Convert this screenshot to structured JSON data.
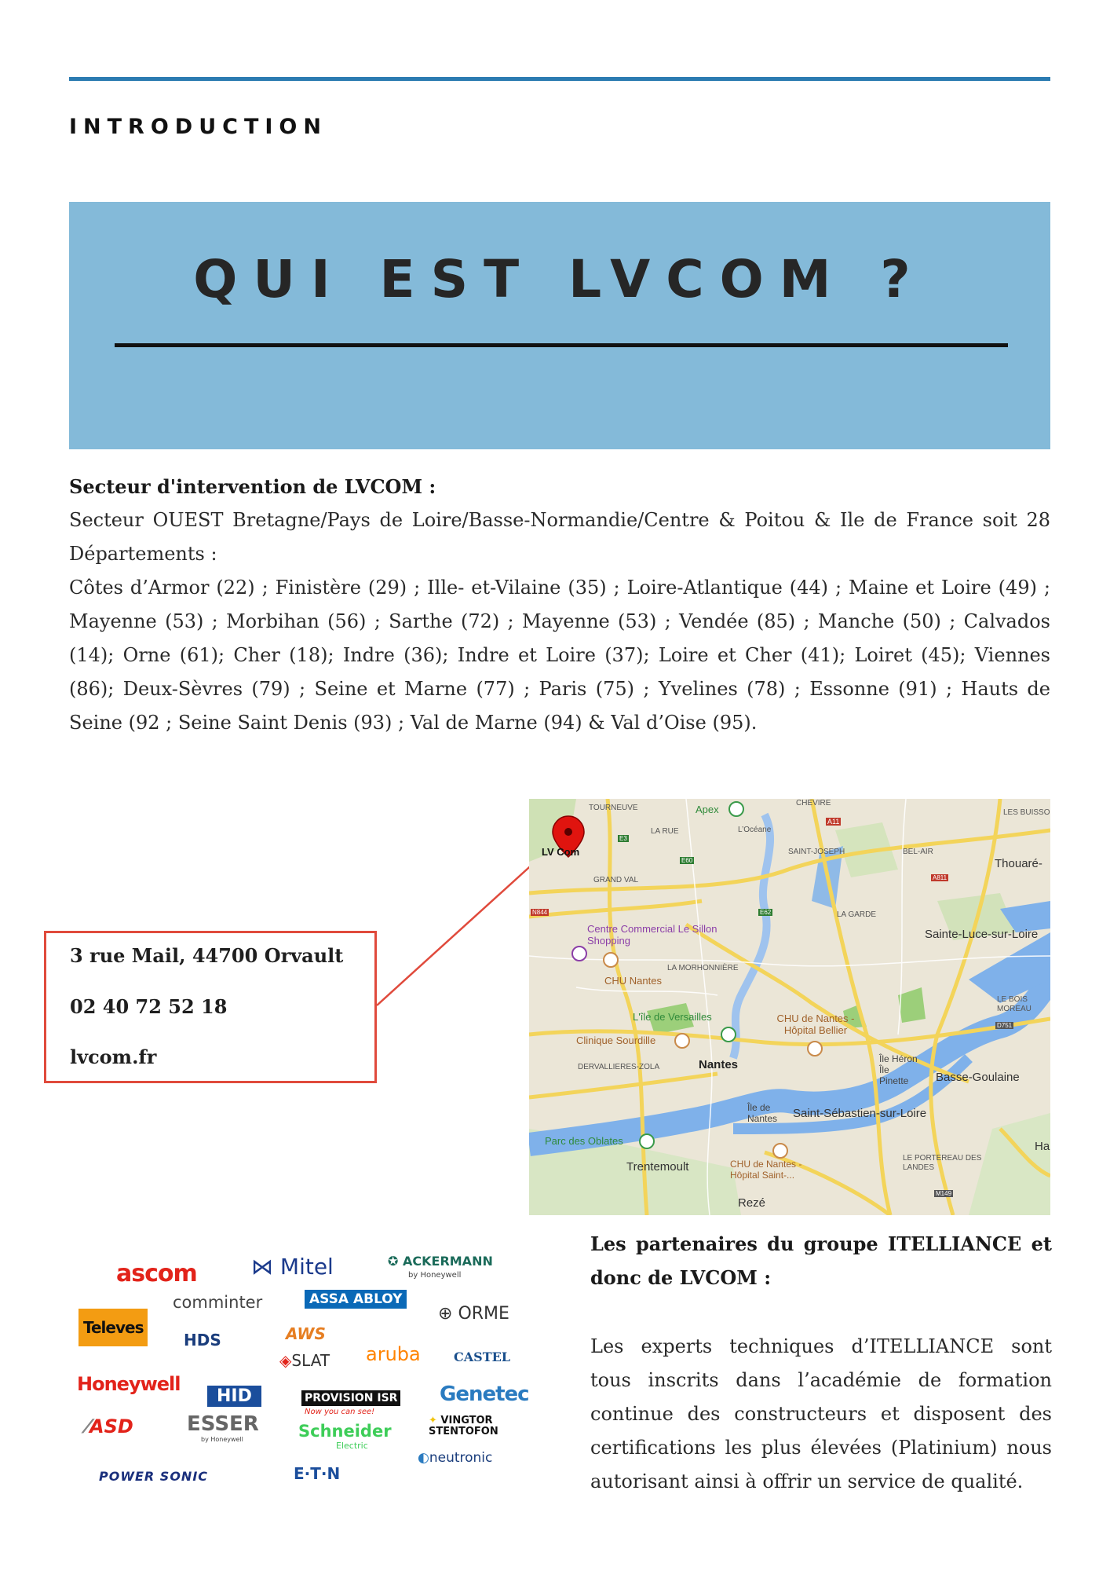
{
  "header": {
    "section_label": "INTRODUCTION"
  },
  "banner": {
    "title": "QUI EST LVCOM ?"
  },
  "sector": {
    "heading": "Secteur d'intervention de LVCOM :",
    "paragraph_1": "Secteur OUEST Bretagne/Pays de Loire/Basse-Normandie/Centre & Poitou & Ile de France soit 28 Départements :",
    "paragraph_2": "Côtes d’Armor (22) ; Finistère (29) ; Ille- et-Vilaine (35) ; Loire-Atlantique (44) ; Maine et Loire (49) ; Mayenne (53) ; Morbihan (56) ; Sarthe (72) ; Mayenne (53) ; Vendée (85) ; Manche (50) ; Calvados (14); Orne (61); Cher (18); Indre (36); Indre et Loire (37); Loire et Cher (41); Loiret (45); Viennes (86); Deux-Sèvres (79) ; Seine et Marne (77) ; Paris (75) ; Yvelines (78) ; Essonne (91) ; Hauts de Seine (92 ; Seine Saint Denis (93) ; Val de Marne (94) & Val d’Oise (95)."
  },
  "contact": {
    "address": "3 rue Mail, 44700 Orvault",
    "phone": "02 40 72 52 18",
    "website": "lvcom.fr"
  },
  "map": {
    "marker_label": "LV Com",
    "places": {
      "tourneuve": "TOURNEUVE",
      "apex": "Apex",
      "chevire": "CHEVIRE",
      "les_buisson": "LES BUISSO",
      "la_rue": "LA RUE",
      "l_oceane": "L’Océane",
      "a11": "A11",
      "saint_joseph": "SAINT-JOSEPH",
      "bel_air": "BEL-AIR",
      "thouare": "Thouaré-",
      "e3": "E3",
      "e60": "E60",
      "grand_val": "GRAND VAL",
      "a811": "A811",
      "n844": "N844",
      "e62": "E62",
      "la_garde": "LA GARDE",
      "centre_commercial": "Centre Commercial Le Sillon Shopping",
      "sainte_luce": "Sainte-Luce-sur-Loire",
      "la_morhonniere": "LA MORHONNIÈRE",
      "chu_nantes": "CHU Nantes",
      "le_bois_moreau": "LE BOIS MOREAU",
      "ile_de_versailles": "L'île de Versailles",
      "chu_bellier": "CHU de Nantes - Hôpital Bellier",
      "d751": "D751",
      "clinique": "Clinique Sourdille",
      "derval": "DERVALLIERES-ZOLA",
      "nantes": "Nantes",
      "ile_heron_pinette": "Île Héron Île Pinette",
      "basse_goulaine": "Basse-Goulaine",
      "ile_de_nantes": "Île de Nantes",
      "saint_sebastien": "Saint-Sébastien-sur-Loire",
      "parc_oblates": "Parc des Oblates",
      "hau": "Hau",
      "trentemoult": "Trentemoult",
      "chu_saint": "CHU de Nantes - Hôpital Saint-...",
      "le_portereau": "LE PORTEREAU DES LANDES",
      "reze": "Rezé",
      "m149": "M149"
    }
  },
  "partners": {
    "heading": "Les partenaires du groupe ITELLIANCE et donc de LVCOM :",
    "text": "Les experts techniques d’ITELLIANCE sont tous inscrits dans l’académie de formation continue des constructeurs et disposent des certifications les plus élevées (Platinium) nous autorisant ainsi à offrir un service de qualité.",
    "logos": {
      "ascom": "ascom",
      "mitel": "Mitel",
      "ackermann": "ACKERMANN",
      "ackermann_sub": "by Honeywell",
      "comminter": "comminter",
      "assa_abloy": "ASSA ABLOY",
      "orme": "ORME",
      "televes": "Televes",
      "hds": "HDS",
      "aws": "AWS",
      "slat": "SLAT",
      "aruba": "aruba",
      "castel": "CASTEL",
      "honeywell": "Honeywell",
      "hid": "HID",
      "provision": "PROVISION ISR",
      "provision_tag": "Now you can see!",
      "genetec": "Genetec",
      "asd": "ASD",
      "esser": "ESSER",
      "esser_sub": "by Honeywell",
      "schneider": "Schneider",
      "schneider_sub": "Electric",
      "vingtor": "VINGTOR STENTOFON",
      "neutronic": "neutronic",
      "powersonic": "POWER SONIC",
      "eaton": "E·T·N"
    },
    "colors": {
      "ascom": "#e2231a",
      "mitel": "#1b3a8c",
      "ackermann": "#1b6b5a",
      "assa_abloy": "#0a69b7",
      "televes": "#f39c12",
      "honeywell": "#e2231a",
      "hid": "#1b4e9c",
      "genetec": "#2a7bc0",
      "schneider": "#3dcd58",
      "aruba": "#ff8300"
    }
  }
}
